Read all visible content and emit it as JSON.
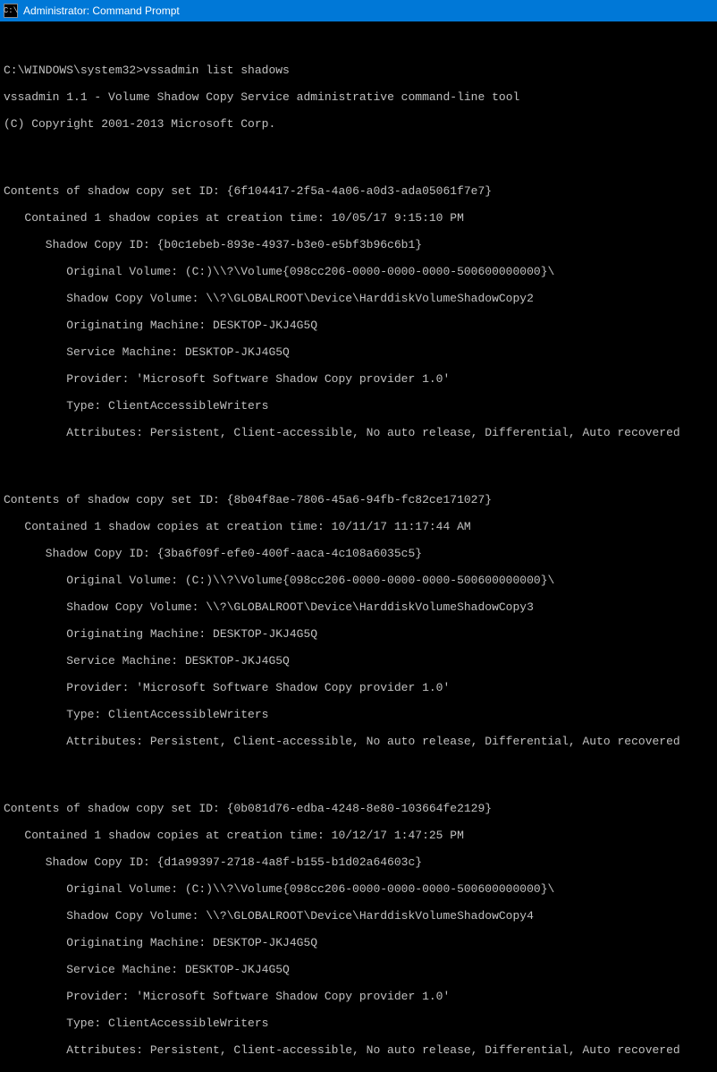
{
  "titlebar": {
    "icon_text": "C:\\",
    "title": "Administrator: Command Prompt"
  },
  "prompt": {
    "path": "C:\\WINDOWS\\system32>",
    "command": "vssadmin list shadows"
  },
  "header": {
    "line1": "vssadmin 1.1 - Volume Shadow Copy Service administrative command-line tool",
    "line2": "(C) Copyright 2001-2013 Microsoft Corp."
  },
  "sets": [
    {
      "set_id": "Contents of shadow copy set ID: {6f104417-2f5a-4a06-a0d3-ada05061f7e7}",
      "contained": "Contained 1 shadow copies at creation time: 10/05/17 9:15:10 PM",
      "copy_id": "Shadow Copy ID: {b0c1ebeb-893e-4937-b3e0-e5bf3b96c6b1}",
      "original_volume": "Original Volume: (C:)\\\\?\\Volume{098cc206-0000-0000-0000-500600000000}\\",
      "shadow_volume": "Shadow Copy Volume: \\\\?\\GLOBALROOT\\Device\\HarddiskVolumeShadowCopy2",
      "originating": "Originating Machine: DESKTOP-JKJ4G5Q",
      "service": "Service Machine: DESKTOP-JKJ4G5Q",
      "provider": "Provider: 'Microsoft Software Shadow Copy provider 1.0'",
      "type": "Type: ClientAccessibleWriters",
      "attributes": "Attributes: Persistent, Client-accessible, No auto release, Differential, Auto recovered"
    },
    {
      "set_id": "Contents of shadow copy set ID: {8b04f8ae-7806-45a6-94fb-fc82ce171027}",
      "contained": "Contained 1 shadow copies at creation time: 10/11/17 11:17:44 AM",
      "copy_id": "Shadow Copy ID: {3ba6f09f-efe0-400f-aaca-4c108a6035c5}",
      "original_volume": "Original Volume: (C:)\\\\?\\Volume{098cc206-0000-0000-0000-500600000000}\\",
      "shadow_volume": "Shadow Copy Volume: \\\\?\\GLOBALROOT\\Device\\HarddiskVolumeShadowCopy3",
      "originating": "Originating Machine: DESKTOP-JKJ4G5Q",
      "service": "Service Machine: DESKTOP-JKJ4G5Q",
      "provider": "Provider: 'Microsoft Software Shadow Copy provider 1.0'",
      "type": "Type: ClientAccessibleWriters",
      "attributes": "Attributes: Persistent, Client-accessible, No auto release, Differential, Auto recovered"
    },
    {
      "set_id": "Contents of shadow copy set ID: {0b081d76-edba-4248-8e80-103664fe2129}",
      "contained": "Contained 1 shadow copies at creation time: 10/12/17 1:47:25 PM",
      "copy_id": "Shadow Copy ID: {d1a99397-2718-4a8f-b155-b1d02a64603c}",
      "original_volume": "Original Volume: (C:)\\\\?\\Volume{098cc206-0000-0000-0000-500600000000}\\",
      "shadow_volume": "Shadow Copy Volume: \\\\?\\GLOBALROOT\\Device\\HarddiskVolumeShadowCopy4",
      "originating": "Originating Machine: DESKTOP-JKJ4G5Q",
      "service": "Service Machine: DESKTOP-JKJ4G5Q",
      "provider": "Provider: 'Microsoft Software Shadow Copy provider 1.0'",
      "type": "Type: ClientAccessibleWriters",
      "attributes": "Attributes: Persistent, Client-accessible, No auto release, Differential, Auto recovered"
    }
  ]
}
